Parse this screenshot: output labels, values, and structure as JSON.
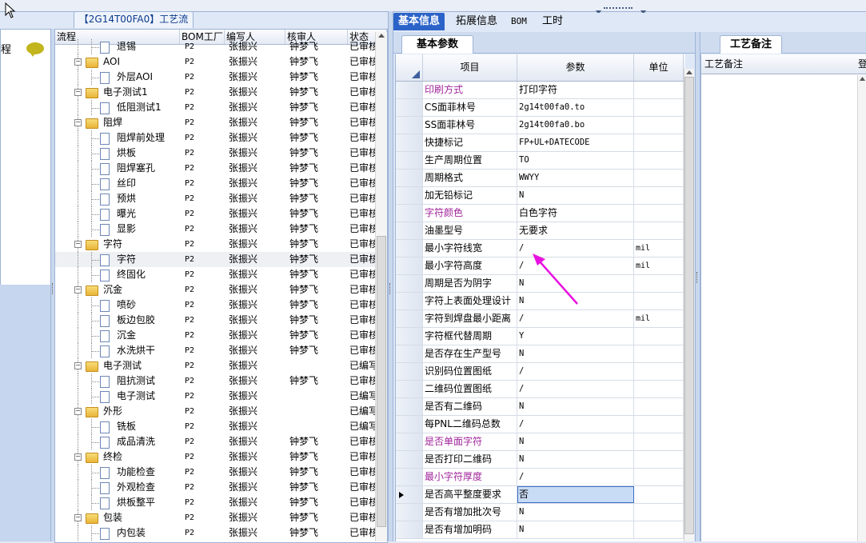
{
  "top_tab": {
    "title": "【2G14T00FA0】工艺流程"
  },
  "left_stub": {
    "label": "程"
  },
  "tree": {
    "columns": [
      "流程",
      "BOM工厂",
      "编写人",
      "核审人",
      "状态"
    ],
    "rows": [
      {
        "level": 1,
        "type": "doc",
        "name": "退锡",
        "factory": "P2",
        "writer": "张振兴",
        "reviewer": "钟梦飞",
        "status": "已审核"
      },
      {
        "level": 0,
        "type": "folder",
        "name": "AOI",
        "factory": "P2",
        "writer": "张振兴",
        "reviewer": "钟梦飞",
        "status": "已审核"
      },
      {
        "level": 1,
        "type": "doc",
        "name": "外层AOI",
        "factory": "P2",
        "writer": "张振兴",
        "reviewer": "钟梦飞",
        "status": "已审核"
      },
      {
        "level": 0,
        "type": "folder",
        "name": "电子测试1",
        "factory": "P2",
        "writer": "张振兴",
        "reviewer": "钟梦飞",
        "status": "已审核"
      },
      {
        "level": 1,
        "type": "doc",
        "name": "低阻测试1",
        "factory": "P2",
        "writer": "张振兴",
        "reviewer": "钟梦飞",
        "status": "已审核"
      },
      {
        "level": 0,
        "type": "folder",
        "name": "阻焊",
        "factory": "P2",
        "writer": "张振兴",
        "reviewer": "钟梦飞",
        "status": "已审核"
      },
      {
        "level": 1,
        "type": "doc",
        "name": "阻焊前处理",
        "factory": "P2",
        "writer": "张振兴",
        "reviewer": "钟梦飞",
        "status": "已审核"
      },
      {
        "level": 1,
        "type": "doc",
        "name": "烘板",
        "factory": "P2",
        "writer": "张振兴",
        "reviewer": "钟梦飞",
        "status": "已审核"
      },
      {
        "level": 1,
        "type": "doc",
        "name": "阻焊塞孔",
        "factory": "P2",
        "writer": "张振兴",
        "reviewer": "钟梦飞",
        "status": "已审核"
      },
      {
        "level": 1,
        "type": "doc",
        "name": "丝印",
        "factory": "P2",
        "writer": "张振兴",
        "reviewer": "钟梦飞",
        "status": "已审核"
      },
      {
        "level": 1,
        "type": "doc",
        "name": "预烘",
        "factory": "P2",
        "writer": "张振兴",
        "reviewer": "钟梦飞",
        "status": "已审核"
      },
      {
        "level": 1,
        "type": "doc",
        "name": "曝光",
        "factory": "P2",
        "writer": "张振兴",
        "reviewer": "钟梦飞",
        "status": "已审核"
      },
      {
        "level": 1,
        "type": "doc",
        "name": "显影",
        "factory": "P2",
        "writer": "张振兴",
        "reviewer": "钟梦飞",
        "status": "已审核"
      },
      {
        "level": 0,
        "type": "folder",
        "name": "字符",
        "factory": "P2",
        "writer": "张振兴",
        "reviewer": "钟梦飞",
        "status": "已审核"
      },
      {
        "level": 1,
        "type": "doc",
        "name": "字符",
        "factory": "P2",
        "writer": "张振兴",
        "reviewer": "钟梦飞",
        "status": "已审核",
        "selected": true
      },
      {
        "level": 1,
        "type": "doc",
        "name": "终固化",
        "factory": "P2",
        "writer": "张振兴",
        "reviewer": "钟梦飞",
        "status": "已审核"
      },
      {
        "level": 0,
        "type": "folder",
        "name": "沉金",
        "factory": "P2",
        "writer": "张振兴",
        "reviewer": "钟梦飞",
        "status": "已审核"
      },
      {
        "level": 1,
        "type": "doc",
        "name": "喷砂",
        "factory": "P2",
        "writer": "张振兴",
        "reviewer": "钟梦飞",
        "status": "已审核"
      },
      {
        "level": 1,
        "type": "doc",
        "name": "板边包胶",
        "factory": "P2",
        "writer": "张振兴",
        "reviewer": "钟梦飞",
        "status": "已审核"
      },
      {
        "level": 1,
        "type": "doc",
        "name": "沉金",
        "factory": "P2",
        "writer": "张振兴",
        "reviewer": "钟梦飞",
        "status": "已审核"
      },
      {
        "level": 1,
        "type": "doc",
        "name": "水洗烘干",
        "factory": "P2",
        "writer": "张振兴",
        "reviewer": "钟梦飞",
        "status": "已审核"
      },
      {
        "level": 0,
        "type": "folder",
        "name": "电子测试",
        "factory": "P2",
        "writer": "张振兴",
        "reviewer": "",
        "status": "已编写"
      },
      {
        "level": 1,
        "type": "doc",
        "name": "阻抗测试",
        "factory": "P2",
        "writer": "张振兴",
        "reviewer": "钟梦飞",
        "status": "已审核"
      },
      {
        "level": 1,
        "type": "doc",
        "name": "电子测试",
        "factory": "P2",
        "writer": "张振兴",
        "reviewer": "",
        "status": "已编写"
      },
      {
        "level": 0,
        "type": "folder",
        "name": "外形",
        "factory": "P2",
        "writer": "张振兴",
        "reviewer": "",
        "status": "已编写"
      },
      {
        "level": 1,
        "type": "doc",
        "name": "铣板",
        "factory": "P2",
        "writer": "张振兴",
        "reviewer": "",
        "status": "已编写"
      },
      {
        "level": 1,
        "type": "doc",
        "name": "成品清洗",
        "factory": "P2",
        "writer": "张振兴",
        "reviewer": "钟梦飞",
        "status": "已审核"
      },
      {
        "level": 0,
        "type": "folder",
        "name": "终检",
        "factory": "P2",
        "writer": "张振兴",
        "reviewer": "钟梦飞",
        "status": "已审核"
      },
      {
        "level": 1,
        "type": "doc",
        "name": "功能检查",
        "factory": "P2",
        "writer": "张振兴",
        "reviewer": "钟梦飞",
        "status": "已审核"
      },
      {
        "level": 1,
        "type": "doc",
        "name": "外观检查",
        "factory": "P2",
        "writer": "张振兴",
        "reviewer": "钟梦飞",
        "status": "已审核"
      },
      {
        "level": 1,
        "type": "doc",
        "name": "烘板整平",
        "factory": "P2",
        "writer": "张振兴",
        "reviewer": "钟梦飞",
        "status": "已审核"
      },
      {
        "level": 0,
        "type": "folder",
        "name": "包装",
        "factory": "P2",
        "writer": "张振兴",
        "reviewer": "钟梦飞",
        "status": "已审核"
      },
      {
        "level": 1,
        "type": "doc",
        "name": "内包装",
        "factory": "P2",
        "writer": "张振兴",
        "reviewer": "钟梦飞",
        "status": "已审核"
      }
    ]
  },
  "main_tabs": [
    "基本信息",
    "拓展信息",
    "BOM",
    "工时"
  ],
  "sub_tab": "基本参数",
  "grid": {
    "columns": [
      "项目",
      "参数",
      "单位"
    ],
    "rows": [
      {
        "item": "印刷方式",
        "value": "打印字符",
        "unit": "",
        "purple": true
      },
      {
        "item": "CS面菲林号",
        "value": "2g14t00fa0.to",
        "unit": ""
      },
      {
        "item": "SS面菲林号",
        "value": "2g14t00fa0.bo",
        "unit": ""
      },
      {
        "item": "快捷标记",
        "value": "FP+UL+DATECODE",
        "unit": ""
      },
      {
        "item": "生产周期位置",
        "value": "TO",
        "unit": ""
      },
      {
        "item": "周期格式",
        "value": "WWYY",
        "unit": ""
      },
      {
        "item": "加无铅标记",
        "value": "N",
        "unit": ""
      },
      {
        "item": "字符颜色",
        "value": "白色字符",
        "unit": "",
        "purple": true
      },
      {
        "item": "油墨型号",
        "value": "无要求",
        "unit": ""
      },
      {
        "item": "最小字符线宽",
        "value": "/",
        "unit": "mil"
      },
      {
        "item": "最小字符高度",
        "value": "/",
        "unit": "mil"
      },
      {
        "item": "周期是否为阴字",
        "value": "N",
        "unit": ""
      },
      {
        "item": "字符上表面处理设计",
        "value": "N",
        "unit": ""
      },
      {
        "item": "字符到焊盘最小距离",
        "value": "/",
        "unit": "mil"
      },
      {
        "item": "字符框代替周期",
        "value": "Y",
        "unit": ""
      },
      {
        "item": "是否存在生产型号",
        "value": "N",
        "unit": ""
      },
      {
        "item": "识别码位置图纸",
        "value": "/",
        "unit": ""
      },
      {
        "item": "二维码位置图纸",
        "value": "/",
        "unit": ""
      },
      {
        "item": "是否有二维码",
        "value": "N",
        "unit": ""
      },
      {
        "item": "每PNL二维码总数",
        "value": "/",
        "unit": ""
      },
      {
        "item": "是否单面字符",
        "value": "N",
        "unit": "",
        "purple": true
      },
      {
        "item": "是否打印二维码",
        "value": "N",
        "unit": ""
      },
      {
        "item": "最小字符厚度",
        "value": "/",
        "unit": "",
        "purple": true
      },
      {
        "item": "是否高平整度要求",
        "value": "否",
        "unit": "",
        "current": true
      },
      {
        "item": "是否有增加批次号",
        "value": "N",
        "unit": ""
      },
      {
        "item": "是否有增加明码",
        "value": "N",
        "unit": ""
      }
    ]
  },
  "right_panel": {
    "tab": "工艺备注",
    "column": "工艺备注",
    "column2": "登"
  },
  "colors": {
    "accent_tab": "#2b63c8",
    "purple_label": "#a0249a",
    "annotation_arrow": "#e812e0"
  }
}
